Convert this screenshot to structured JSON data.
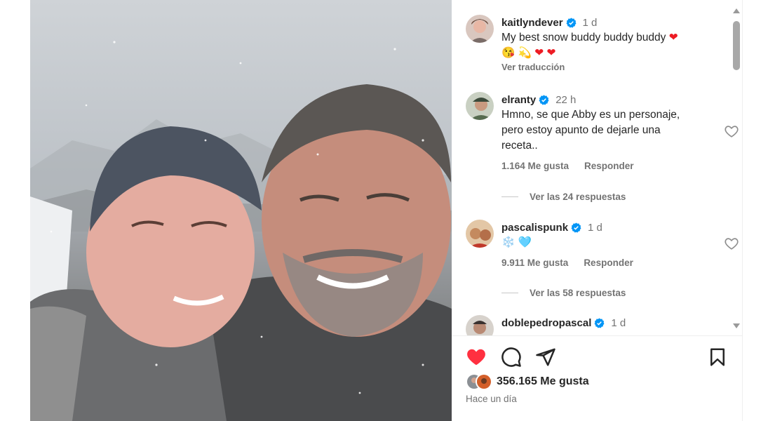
{
  "post": {
    "photo_alt": "",
    "likes_count": "356.165 Me gusta",
    "posted_ago": "Hace un día"
  },
  "comments": [
    {
      "username": "kaitlyndever",
      "time": "1 d",
      "text": "My best snow buddy buddy buddy ",
      "emoji_line": "😘 💫 ",
      "translate": "Ver traducción"
    },
    {
      "username": "elranty",
      "time": "22 h",
      "text": "Hmno, se que Abby es un personaje, pero estoy apunto de dejarle una receta..",
      "likes": "1.164 Me gusta",
      "reply": "Responder",
      "replies": "Ver las 24 respuestas"
    },
    {
      "username": "pascalispunk",
      "time": "1 d",
      "text": "❄️ 🩵",
      "likes": "9.911 Me gusta",
      "reply": "Responder",
      "replies": "Ver las 58 respuestas"
    },
    {
      "username": "doblepedropascal",
      "time": "1 d"
    }
  ],
  "icons": {
    "like": "heart-filled-icon",
    "comment": "comment-bubble-icon",
    "share": "send-paper-plane-icon",
    "save": "bookmark-icon",
    "verified": "verified-badge-icon"
  },
  "colors": {
    "like_red": "#ff3040",
    "verified_blue": "#0095f6",
    "muted_text": "#737373"
  }
}
